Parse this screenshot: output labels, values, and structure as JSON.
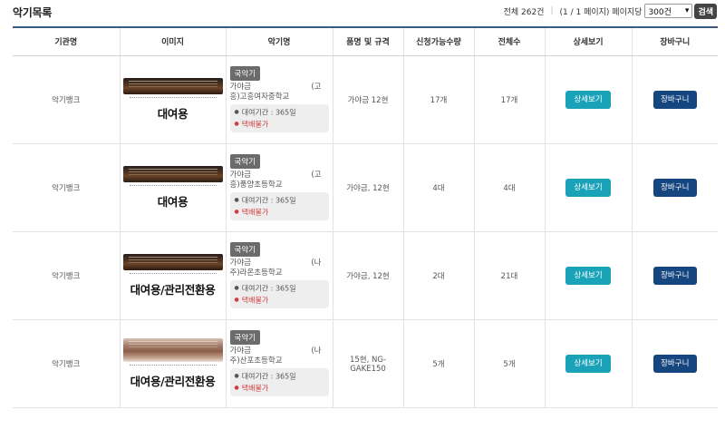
{
  "page_title": "악기목록",
  "toolbar": {
    "total_text": "전체 262건",
    "page_info_text": "(1 / 1 페이지) 페이지당",
    "per_page_value": "300건",
    "search_label": "검색"
  },
  "table": {
    "headers": [
      "기관명",
      "이미지",
      "악기명",
      "품명 및 규격",
      "신청가능수량",
      "전체수",
      "상세보기",
      "장바구니"
    ],
    "rows": [
      {
        "org": "악기뱅크",
        "image_label": "대여용",
        "image_style": "dark",
        "category": "국악기",
        "name_a": "가야금",
        "name_b": "(고",
        "name_c": "흥)고흥여자중학교",
        "rental_period": "대여기간 : 365일",
        "delivery": "택배불가",
        "spec": "가야금 12현",
        "available": "17개",
        "total": "17개",
        "detail_label": "상세보기",
        "cart_label": "장바구니"
      },
      {
        "org": "악기뱅크",
        "image_label": "대여용",
        "image_style": "dark",
        "category": "국악기",
        "name_a": "가야금",
        "name_b": "(고",
        "name_c": "흥)풍양초등학교",
        "rental_period": "대여기간 : 365일",
        "delivery": "택배불가",
        "spec": "가야금, 12현",
        "available": "4대",
        "total": "4대",
        "detail_label": "상세보기",
        "cart_label": "장바구니"
      },
      {
        "org": "악기뱅크",
        "image_label": "대여용/관리전환용",
        "image_style": "dark",
        "category": "국악기",
        "name_a": "가야금",
        "name_b": "(나",
        "name_c": "주)라온초등학교",
        "rental_period": "대여기간 : 365일",
        "delivery": "택배불가",
        "spec": "가야금, 12현",
        "available": "2대",
        "total": "21대",
        "detail_label": "상세보기",
        "cart_label": "장바구니"
      },
      {
        "org": "악기뱅크",
        "image_label": "대여용/관리전환용",
        "image_style": "light",
        "category": "국악기",
        "name_a": "가야금",
        "name_b": "(나",
        "name_c": "주)산포초등학교",
        "rental_period": "대여기간 : 365일",
        "delivery": "택배불가",
        "spec": "15현, NG-GAKE150",
        "available": "5개",
        "total": "5개",
        "detail_label": "상세보기",
        "cart_label": "장바구니"
      }
    ]
  },
  "colors": {
    "header_rule": "#3b5a80",
    "detail_button": "#1aa3b8",
    "cart_button": "#15467f",
    "delivery_text": "#d23b3b"
  }
}
